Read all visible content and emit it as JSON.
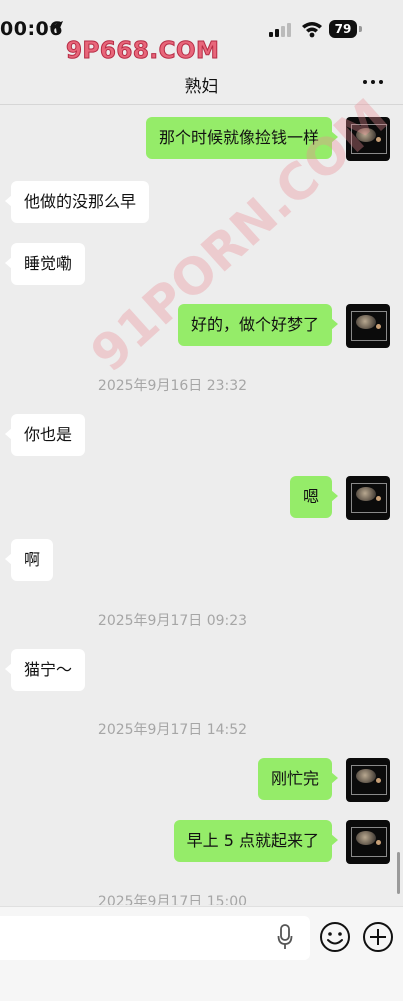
{
  "status_bar": {
    "time": "00:06",
    "battery": "79"
  },
  "watermark": {
    "site": "9P668.COM",
    "diagonal": "91PORN.COM"
  },
  "header": {
    "title": "熟妇"
  },
  "messages": [
    {
      "side": "mine",
      "text": "那个时候就像捡钱一样"
    },
    {
      "side": "theirs",
      "text": "他做的没那么早"
    },
    {
      "side": "theirs",
      "text": "睡觉嘞"
    },
    {
      "side": "mine",
      "text": "好的，做个好梦了"
    },
    {
      "timestamp": "2025年9月16日 23:32"
    },
    {
      "side": "theirs",
      "text": "你也是"
    },
    {
      "side": "mine",
      "text": "嗯"
    },
    {
      "side": "theirs",
      "text": "啊"
    },
    {
      "timestamp": "2025年9月17日 09:23"
    },
    {
      "side": "theirs",
      "text": "猫宁～"
    },
    {
      "timestamp": "2025年9月17日 14:52"
    },
    {
      "side": "mine",
      "text": "刚忙完"
    },
    {
      "side": "mine",
      "text": "早上 5 点就起来了"
    },
    {
      "timestamp": "2025年9月17日 15:00"
    }
  ],
  "icons": {
    "more": "more-icon",
    "mic": "mic-icon",
    "emoji": "emoji-icon",
    "plus": "plus-icon"
  },
  "colors": {
    "mine_bubble": "#95ec69",
    "theirs_bubble": "#ffffff",
    "background": "#ededed"
  }
}
